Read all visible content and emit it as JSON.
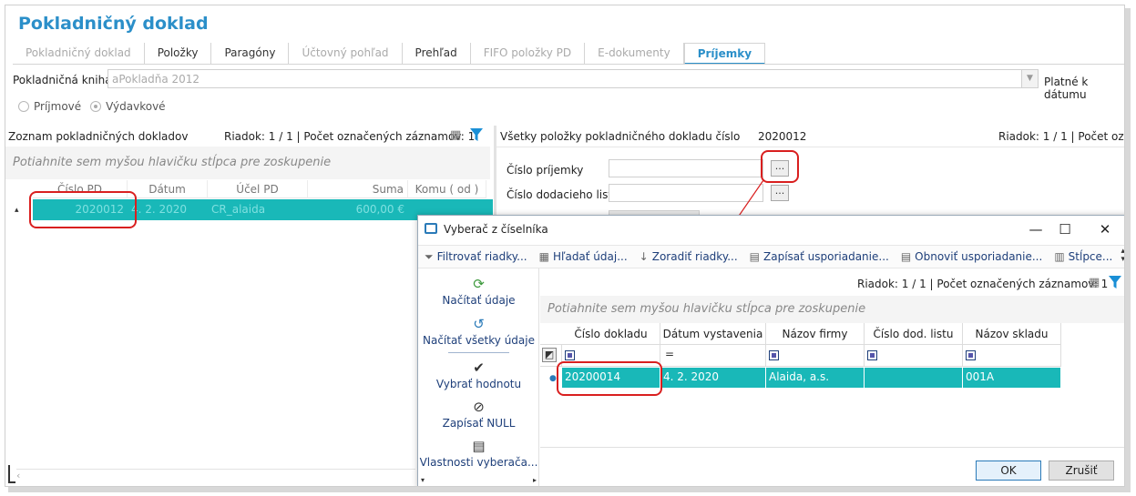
{
  "window": {
    "title": "Pokladničný doklad"
  },
  "tabs": [
    {
      "label": "Pokladničný doklad",
      "state": "disabled"
    },
    {
      "label": "Položky",
      "state": "normal"
    },
    {
      "label": "Paragóny",
      "state": "normal"
    },
    {
      "label": "Účtovný pohľad",
      "state": "disabled"
    },
    {
      "label": "Prehľad",
      "state": "normal"
    },
    {
      "label": "FIFO položky PD",
      "state": "disabled"
    },
    {
      "label": "E-dokumenty",
      "state": "disabled"
    },
    {
      "label": "Príjemky",
      "state": "active"
    }
  ],
  "cash_book": {
    "label": "Pokladničná kniha",
    "value": "aPokladňa 2012",
    "date_label": "Platné k dátumu"
  },
  "radios": [
    {
      "label": "Príjmové",
      "checked": false
    },
    {
      "label": "Výdavkové",
      "checked": true
    }
  ],
  "left_panel": {
    "heading": "Zoznam pokladničných dokladov",
    "count": "Riadok: 1 / 1 | Počet označených záznamov: 1",
    "group_hint": "Potiahnite sem myšou hlavičku stĺpca pre zoskupenie",
    "columns": [
      "Číslo PD",
      "Dátum",
      "Účel PD",
      "Suma",
      "Komu ( od )"
    ],
    "rows": [
      {
        "cislo_pd": "2020012",
        "datum": "4. 2. 2020",
        "ucel": "CR_alaida",
        "suma": "600,00 €",
        "komu": ""
      }
    ]
  },
  "right_panel": {
    "heading": "Všetky položky pokladničného dokladu číslo",
    "doc_number": "2020012",
    "count": "Riadok: 1 / 1 | Počet ozna",
    "fields": [
      {
        "label": "Číslo príjemky",
        "value": "",
        "button": "..."
      },
      {
        "label": "Číslo dodacieho listu",
        "value": "",
        "button": "..."
      }
    ]
  },
  "dialog": {
    "title": "Vyberač z číselníka",
    "window_buttons": {
      "minimize": "—",
      "maximize": "☐",
      "close": "✕"
    },
    "toolbar": [
      {
        "label": "Filtrovať riadky...",
        "icon": "filter-icon"
      },
      {
        "label": "Hľadať údaj...",
        "icon": "search-grid-icon"
      },
      {
        "label": "Zoradiť riadky...",
        "icon": "sort-icon"
      },
      {
        "label": "Zapísať usporiadanie...",
        "icon": "save-layout-icon"
      },
      {
        "label": "Obnoviť usporiadanie...",
        "icon": "restore-layout-icon"
      },
      {
        "label": "Stĺpce...",
        "icon": "columns-icon"
      }
    ],
    "side_actions": [
      {
        "label": "Načítať údaje",
        "icon": "refresh-icon"
      },
      {
        "label": "Načítať všetky údaje",
        "icon": "reload-icon"
      },
      {
        "label": "Vybrať hodnotu",
        "icon": "checkmark-icon"
      },
      {
        "label": "Zapísať NULL",
        "icon": "null-icon"
      },
      {
        "label": "Vlastnosti vyberača...",
        "icon": "properties-icon"
      }
    ],
    "count": "Riadok: 1 / 1 | Počet označených záznamov: 1",
    "group_hint": "Potiahnite sem myšou hlavičku stĺpca pre zoskupenie",
    "columns": [
      "Číslo dokladu",
      "Dátum vystavenia",
      "Názov firmy",
      "Číslo dod. listu",
      "Názov skladu"
    ],
    "filter_ops": [
      "",
      "=",
      "",
      "",
      ""
    ],
    "rows": [
      {
        "cislo": "20200014",
        "datum": "4. 2. 2020",
        "firma": "Alaida, a.s.",
        "dod_list": "",
        "sklad": "001A"
      }
    ],
    "ok_label": "OK",
    "cancel_label": "Zrušiť"
  },
  "colors": {
    "accent": "#2b8fc9",
    "selection": "#19b8b8",
    "annotation": "#d91f1f"
  }
}
